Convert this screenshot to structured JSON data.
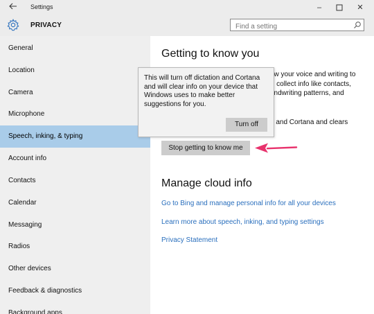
{
  "window": {
    "title": "Settings",
    "controls": {
      "minimize": "–",
      "maximize": "☐",
      "close": "✕"
    }
  },
  "header": {
    "section": "PRIVACY",
    "search_placeholder": "Find a setting"
  },
  "sidebar": {
    "active_index": 4,
    "items": [
      {
        "label": "General"
      },
      {
        "label": "Location"
      },
      {
        "label": "Camera"
      },
      {
        "label": "Microphone"
      },
      {
        "label": "Speech, inking, & typing"
      },
      {
        "label": "Account info"
      },
      {
        "label": "Contacts"
      },
      {
        "label": "Calendar"
      },
      {
        "label": "Messaging"
      },
      {
        "label": "Radios"
      },
      {
        "label": "Other devices"
      },
      {
        "label": "Feedback & diagnostics"
      },
      {
        "label": "Background apps"
      }
    ]
  },
  "main": {
    "getting_to_know": {
      "heading": "Getting to know you",
      "text_line1": "ew your voice and writing to",
      "text_line2": "'ll collect info like contacts,",
      "text_line3": "andwriting patterns, and",
      "text_line4": "n and Cortana and clears",
      "stop_button": "Stop getting to know me"
    },
    "cloud": {
      "heading": "Manage cloud info",
      "link_bing": "Go to Bing and manage personal info for all your devices",
      "link_learn": "Learn more about speech, inking, and typing settings",
      "link_privacy": "Privacy Statement"
    }
  },
  "flyout": {
    "message": "This will turn off dictation and Cortana and will clear info on your device that Windows uses to make better suggestions for you.",
    "button": "Turn off"
  },
  "colors": {
    "accent_selected": "#a9cce9",
    "link": "#2a6fbd",
    "annotation_arrow": "#e8336d"
  }
}
